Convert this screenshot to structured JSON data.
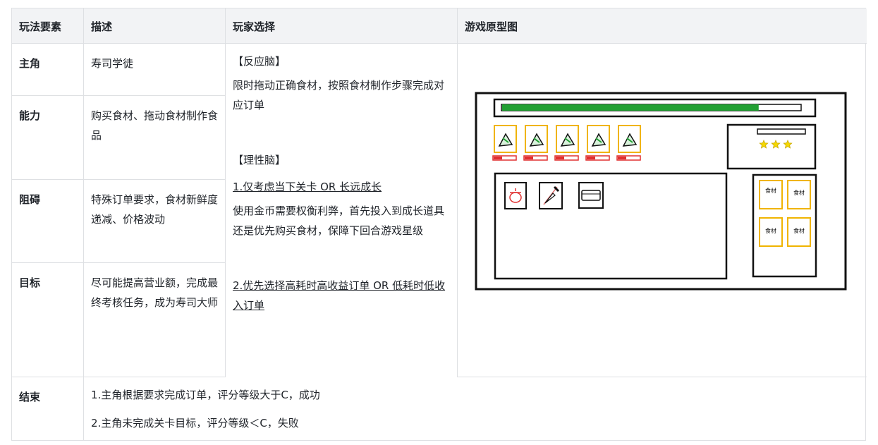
{
  "headers": [
    "玩法要素",
    "描述",
    "玩家选择",
    "游戏原型图"
  ],
  "rows": [
    {
      "label": "主角",
      "desc": "寿司学徒"
    },
    {
      "label": "能力",
      "desc": "购买食材、拖动食材制作食品"
    },
    {
      "label": "阻碍",
      "desc": "特殊订单要求，食材新鲜度递减、价格波动"
    },
    {
      "label": "目标",
      "desc": "尽可能提高营业额，完成最终考核任务，成为寿司大师"
    }
  ],
  "choices": {
    "reaction_title": "【反应脑】",
    "reaction_text": "限时拖动正确食材，按照食材制作步骤完成对应订单",
    "rational_title": "【理性脑】",
    "point1": "1.仅考虑当下关卡 OR 长远成长",
    "point1_text": "使用金币需要权衡利弊，首先投入到成长道具还是优先购买食材，保障下回合游戏星级",
    "point2": "2.优先选择高耗时高收益订单 OR 低耗时低收入订单"
  },
  "prototype": {
    "ingredient_label": "食材",
    "progress_color": "#22a033",
    "star_color": "#f5d800",
    "slot_border_color": "#f0b400",
    "freshness_color": "#e03030",
    "progress_fraction": 0.86,
    "stars": 3,
    "order_cards": 5,
    "tools": [
      "pot-icon",
      "knife-icon",
      "bowl-icon"
    ]
  },
  "end": {
    "label": "结束",
    "line1": "1.主角根据要求完成订单，评分等级大于C，成功",
    "line2": "2.主角未完成关卡目标，评分等级＜C，失败"
  }
}
